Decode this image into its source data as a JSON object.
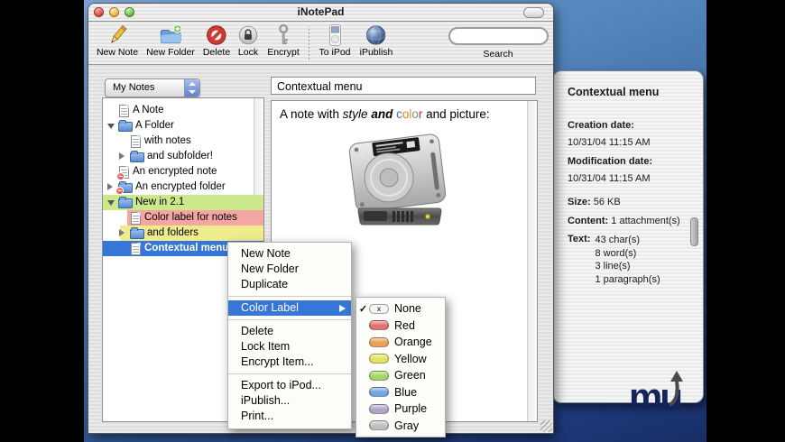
{
  "window": {
    "title": "iNotePad"
  },
  "toolbar": {
    "items": [
      {
        "label": "New Note",
        "icon": "pencil-icon"
      },
      {
        "label": "New Folder",
        "icon": "folder-plus-icon"
      },
      {
        "label": "Delete",
        "icon": "prohibition-icon"
      },
      {
        "label": "Lock",
        "icon": "padlock-icon"
      },
      {
        "label": "Encrypt",
        "icon": "key-icon"
      },
      {
        "label": "To iPod",
        "icon": "ipod-icon"
      },
      {
        "label": "iPublish",
        "icon": "globe-icon"
      }
    ],
    "search_label": "Search",
    "search_value": ""
  },
  "sidebar": {
    "popup_label": "My Notes",
    "tree": [
      {
        "label": "A Note",
        "icon": "note-icon",
        "indent": 1
      },
      {
        "label": "A Folder",
        "icon": "folder-icon",
        "indent": 1,
        "disclosure": "open"
      },
      {
        "label": "with notes",
        "icon": "note-icon",
        "indent": 2
      },
      {
        "label": "and subfolder!",
        "icon": "folder-icon",
        "indent": 2,
        "disclosure": "closed"
      },
      {
        "label": "An encrypted note",
        "icon": "note-encrypted-icon",
        "indent": 1
      },
      {
        "label": "An encrypted folder",
        "icon": "folder-encrypted-icon",
        "indent": 1,
        "disclosure": "closed"
      },
      {
        "label": "New in 2.1",
        "icon": "folder-icon",
        "indent": 1,
        "disclosure": "open",
        "highlight": "green"
      },
      {
        "label": "Color label for notes",
        "icon": "note-icon",
        "indent": 2,
        "highlight": "red"
      },
      {
        "label": "and folders",
        "icon": "folder-icon",
        "indent": 2,
        "disclosure": "closed",
        "highlight": "yellow"
      },
      {
        "label": "Contextual menu",
        "icon": "note-icon",
        "indent": 2,
        "highlight": "selected"
      }
    ]
  },
  "note": {
    "title": "Contextual menu",
    "body_segments": [
      {
        "t": "A note with ",
        "s": "plain"
      },
      {
        "t": "style",
        "s": "italic"
      },
      {
        "t": " ",
        "s": "plain"
      },
      {
        "t": "and",
        "s": "bold-italic"
      },
      {
        "t": " ",
        "s": "plain"
      },
      {
        "t": "color",
        "s": "plain",
        "colors": [
          "#3b6fd4",
          "#e8820a",
          "#b0ad39",
          "#8b8b8b",
          "#d42a2a"
        ]
      },
      {
        "t": " and picture:",
        "s": "plain"
      }
    ],
    "picture": "hard-drive-image"
  },
  "drawer": {
    "title": "Contextual menu",
    "creation_label": "Creation date:",
    "creation_value": "10/31/04 11:15 AM",
    "modification_label": "Modification date:",
    "modification_value": "10/31/04 11:15 AM",
    "size_label": "Size:",
    "size_value": "56 KB",
    "content_label": "Content:",
    "content_value": "1 attachment(s)",
    "text_label": "Text:",
    "text_values": [
      "43 char(s)",
      "8 word(s)",
      "3 line(s)",
      "1 paragraph(s)"
    ]
  },
  "context_menu": {
    "items": [
      {
        "label": "New Note"
      },
      {
        "label": "New Folder"
      },
      {
        "label": "Duplicate"
      },
      {
        "label": "Color Label",
        "highlighted": true,
        "has_submenu": true
      },
      {
        "label": "Delete"
      },
      {
        "label": "Lock Item"
      },
      {
        "label": "Encrypt Item..."
      },
      {
        "label": "Export to iPod..."
      },
      {
        "label": "iPublish..."
      },
      {
        "label": "Print..."
      }
    ]
  },
  "submenu": {
    "check_glyph": "✓",
    "none_glyph": "x",
    "items": [
      {
        "label": "None",
        "checked": true,
        "pill": "none"
      },
      {
        "label": "Red",
        "color": "#e2716f"
      },
      {
        "label": "Orange",
        "color": "#e9a254"
      },
      {
        "label": "Yellow",
        "color": "#e3e35e"
      },
      {
        "label": "Green",
        "color": "#a2d768"
      },
      {
        "label": "Blue",
        "color": "#74a5e2"
      },
      {
        "label": "Purple",
        "color": "#b3a6c6"
      },
      {
        "label": "Gray",
        "color": "#bfbfbf"
      }
    ]
  },
  "watermark": {
    "text": "mu"
  },
  "colors": {
    "selection": "#3576d6",
    "label_green": "#cbe98b",
    "label_red": "#f3a6a2",
    "label_yellow": "#efec8e"
  }
}
